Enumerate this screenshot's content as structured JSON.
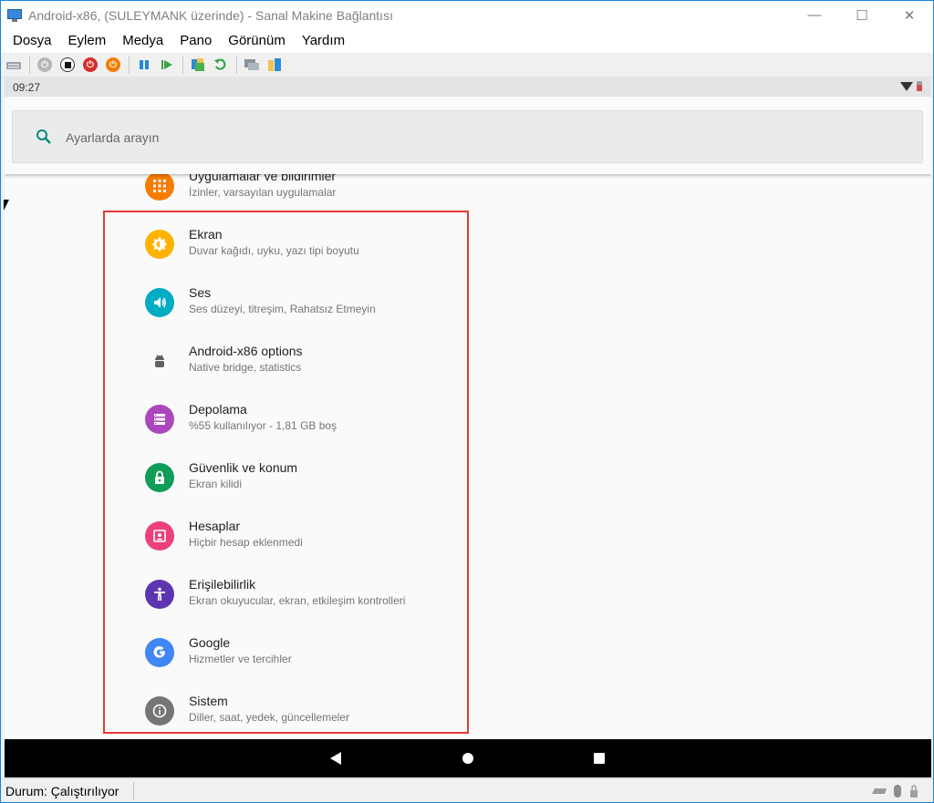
{
  "window": {
    "title": "Android-x86, (SULEYMANK üzerinde) - Sanal Makine Bağlantısı",
    "controls": {
      "minimize": "—",
      "maximize": "☐",
      "close": "✕"
    }
  },
  "menu": [
    "Dosya",
    "Eylem",
    "Medya",
    "Pano",
    "Görünüm",
    "Yardım"
  ],
  "toolbar": {
    "buttons": [
      "ctrl-alt-del-icon",
      "start-icon",
      "turn-off-icon",
      "shutdown-icon",
      "power-icon",
      "pause-icon",
      "resume-icon",
      "checkpoint-icon",
      "revert-icon",
      "enhanced-session-icon",
      "share-icon"
    ]
  },
  "android": {
    "status_time": "09:27",
    "search_placeholder": "Ayarlarda arayın",
    "settings": [
      {
        "title": "Uygulamalar ve bildirimler",
        "subtitle": "İzinler, varsayılan uygulamalar",
        "icon": "apps-grid-icon",
        "color": "#f57c00"
      },
      {
        "title": "Ekran",
        "subtitle": "Duvar kağıdı, uyku, yazı tipi boyutu",
        "icon": "brightness-icon",
        "color": "#ffb300"
      },
      {
        "title": "Ses",
        "subtitle": "Ses düzeyi, titreşim, Rahatsız Etmeyin",
        "icon": "volume-icon",
        "color": "#00acc1"
      },
      {
        "title": "Android-x86 options",
        "subtitle": "Native bridge, statistics",
        "icon": "android-robot-icon",
        "color": "#616161"
      },
      {
        "title": "Depolama",
        "subtitle": "%55 kullanılıyor - 1,81 GB boş",
        "icon": "storage-icon",
        "color": "#ab47bc"
      },
      {
        "title": "Güvenlik ve konum",
        "subtitle": "Ekran kilidi",
        "icon": "lock-icon",
        "color": "#0f9d58"
      },
      {
        "title": "Hesaplar",
        "subtitle": "Hiçbir hesap eklenmedi",
        "icon": "account-icon",
        "color": "#ec407a"
      },
      {
        "title": "Erişilebilirlik",
        "subtitle": "Ekran okuyucular, ekran, etkileşim kontrolleri",
        "icon": "accessibility-icon",
        "color": "#5e35b1"
      },
      {
        "title": "Google",
        "subtitle": "Hizmetler ve tercihler",
        "icon": "google-icon",
        "color": "#4285f4"
      },
      {
        "title": "Sistem",
        "subtitle": "Diller, saat, yedek, güncellemeler",
        "icon": "info-icon",
        "color": "#757575"
      }
    ],
    "highlight_color": "#e53935"
  },
  "footer": {
    "status": "Durum: Çalıştırılıyor"
  }
}
